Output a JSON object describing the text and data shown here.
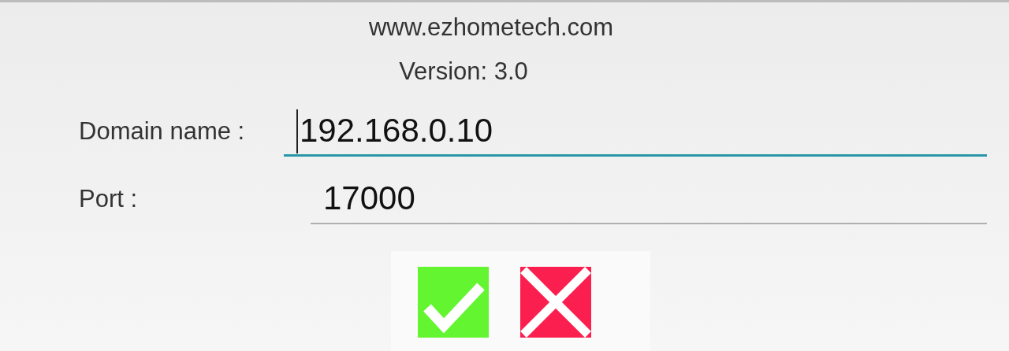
{
  "header": {
    "website": "www.ezhometech.com",
    "version": "Version: 3.0"
  },
  "fields": [
    {
      "label": "Domain name :",
      "value": "192.168.0.10",
      "focused": true
    },
    {
      "label": "Port :",
      "value": "17000",
      "focused": false
    }
  ],
  "buttons": [
    {
      "kind": "confirm"
    },
    {
      "kind": "cancel"
    }
  ]
}
